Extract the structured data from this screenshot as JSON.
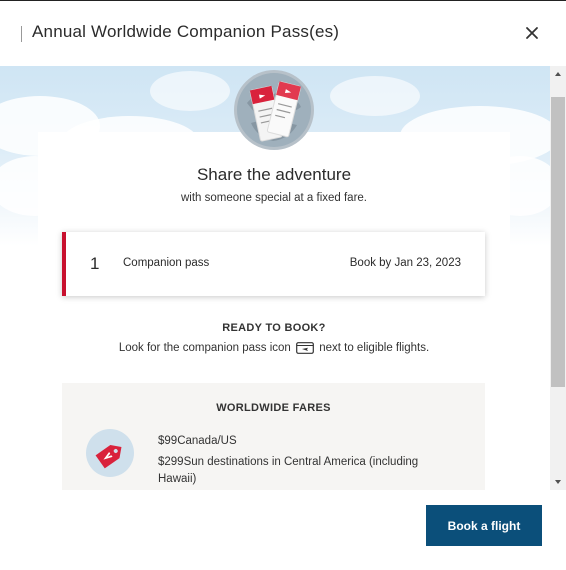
{
  "header": {
    "title": "Annual Worldwide Companion Pass(es)",
    "close_icon": "close-icon"
  },
  "hero": {
    "icon": "boarding-passes-icon",
    "heading": "Share the adventure",
    "subheading": "with someone special at a fixed fare."
  },
  "pass": {
    "count": "1",
    "label": "Companion pass",
    "book_by": "Book by Jan 23, 2023",
    "accent_color": "#c8102e"
  },
  "ready": {
    "title": "READY TO BOOK?",
    "text_before_icon": "Look for the companion pass icon",
    "icon": "companion-pass-ticket-icon",
    "text_after_icon": "next to eligible flights."
  },
  "fares": {
    "title": "WORLDWIDE FARES",
    "icon": "price-tag-plane-icon",
    "rows": [
      {
        "price": "$99",
        "destination": "Canada/US"
      },
      {
        "price": "$299",
        "destination": "Sun destinations in Central America (including Hawaii)"
      }
    ]
  },
  "footer": {
    "book_button_label": "Book a flight",
    "button_color": "#0b4f7a"
  }
}
